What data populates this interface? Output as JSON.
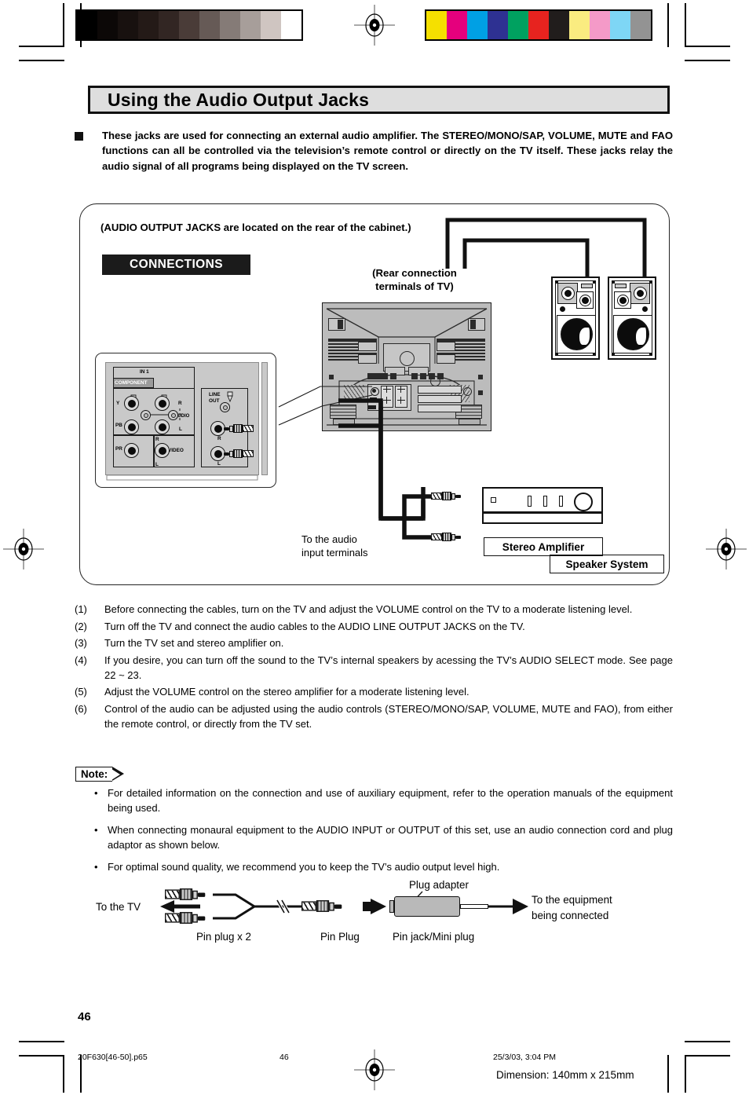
{
  "page": {
    "title": "Using the Audio Output Jacks",
    "page_number": "46"
  },
  "intro": {
    "text": "These jacks are used for connecting an external audio amplifier. The STEREO/MONO/SAP, VOLUME, MUTE and FAO functions can all be controlled via the television’s remote control or directly on the TV itself. These jacks relay the audio signal of all programs being displayed on the TV screen."
  },
  "figure": {
    "caption": "(AUDIO OUTPUT JACKS are located on the rear of the cabinet.)",
    "connections_tag": "CONNECTIONS",
    "rear_caption_line1": "(Rear connection",
    "rear_caption_line2": "terminals of TV)",
    "jack_panel": {
      "in1": "IN 1",
      "component": "COMPONENT",
      "y": "Y",
      "pb": "PB",
      "pr": "PR",
      "audio": "AUDIO",
      "r": "R",
      "l": "L",
      "video": "VIDEO",
      "line_out_line1": "LINE",
      "line_out_line2": "OUT",
      "out_r": "R",
      "out_l": "L"
    },
    "audio_input_label_line1": "To the audio",
    "audio_input_label_line2": "input terminals",
    "amplifier_label": "Stereo  Amplifier",
    "speaker_label": "Speaker  System"
  },
  "steps": [
    {
      "n": "(1)",
      "text": "Before connecting the cables, turn on the TV and adjust the VOLUME control on the TV to a moderate listening level."
    },
    {
      "n": "(2)",
      "text": "Turn off the TV and connect the audio cables to the AUDIO LINE OUTPUT JACKS on the TV."
    },
    {
      "n": "(3)",
      "text": "Turn the TV set and stereo amplifier on."
    },
    {
      "n": "(4)",
      "text": "If you desire, you can turn off the sound to the TV’s internal speakers by acessing the TV’s AUDIO SELECT mode. See page 22 ~ 23."
    },
    {
      "n": "(5)",
      "text": "Adjust the VOLUME control on the stereo amplifier for a moderate listening level."
    },
    {
      "n": "(6)",
      "text": "Control of the audio can be adjusted using the audio controls (STEREO/MONO/SAP, VOLUME, MUTE and FAO), from either the remote control, or directly from the TV set."
    }
  ],
  "note": {
    "label": "Note:",
    "bullet_glyph": "•",
    "items": [
      "For detailed information on the connection and use of auxiliary equipment, refer to the operation manuals of the equipment being used.",
      "When connecting monaural equipment to the AUDIO INPUT or OUTPUT of this set, use an audio connection cord and plug adaptor as shown below.",
      "For optimal sound quality, we recommend you to keep the TV’s audio output level high."
    ]
  },
  "adapter_diagram": {
    "to_tv": "To the TV",
    "pin_plug_x2": "Pin plug x 2",
    "pin_plug": "Pin Plug",
    "pin_jack_mini_plug": "Pin jack/Mini plug",
    "plug_adapter": "Plug adapter",
    "to_equipment_line1": "To the equipment",
    "to_equipment_line2": "being connected"
  },
  "footer": {
    "filename": "20F630[46-50].p65",
    "page": "46",
    "timestamp": "25/3/03, 3:04 PM",
    "dimension": "Dimension: 140mm x 215mm"
  },
  "calibration": {
    "gray_swatches": [
      "#000000",
      "#0c0807",
      "#18110f",
      "#241a17",
      "#322623",
      "#4a3c38",
      "#665a56",
      "#857b77",
      "#a79e9a",
      "#cfc5c1",
      "#ffffff"
    ],
    "color_swatches": [
      "#f5e000",
      "#e5007d",
      "#00a0e4",
      "#2e3192",
      "#00a160",
      "#e7231f",
      "#211d1c",
      "#faec80",
      "#f49ac8",
      "#7ed6f5",
      "#939393"
    ]
  }
}
